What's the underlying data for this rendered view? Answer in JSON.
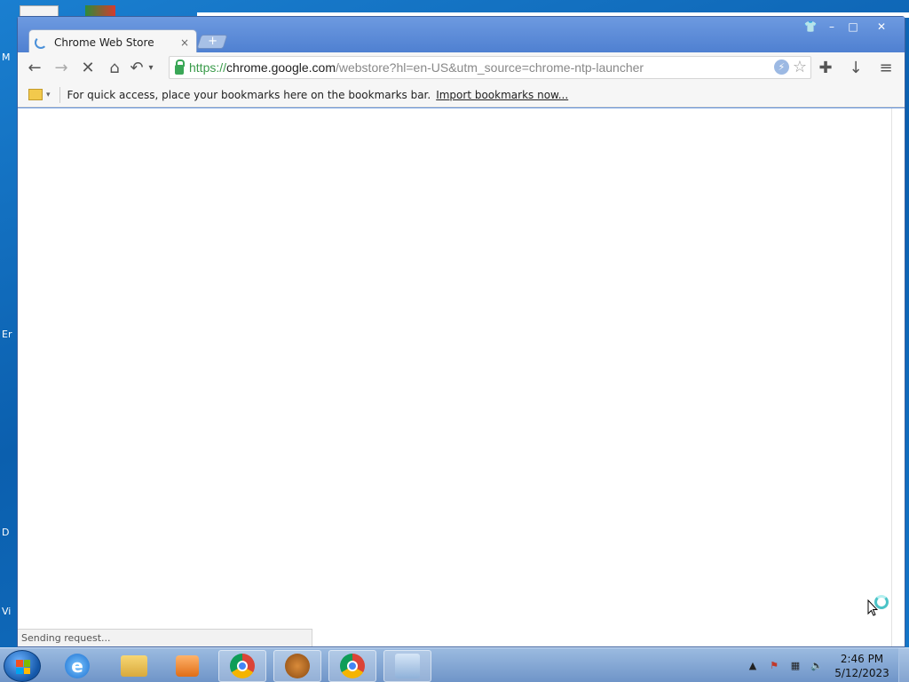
{
  "desktop": {
    "labels": [
      "M",
      "Er",
      "D",
      "Vi"
    ]
  },
  "browser": {
    "tab": {
      "title": "Chrome Web Store",
      "close_label": "×"
    },
    "new_tab_label": "+",
    "window_controls": {
      "minimize": "–",
      "maximize": "□",
      "close": "✕",
      "profile": "👕"
    },
    "toolbar": {
      "back": "←",
      "forward": "→",
      "stop": "✕",
      "home": "⌂",
      "undo": "↶",
      "undo_caret": "▾",
      "url": {
        "scheme": "https://",
        "host": "chrome.google.com",
        "rest": "/webstore?hl=en-US&utm_source=chrome-ntp-launcher"
      },
      "extensions": "✚",
      "download": "↓",
      "menu": "≡"
    },
    "bookmarks_bar": {
      "caret": "▾",
      "prompt": "For quick access, place your bookmarks here on the bookmarks bar.",
      "import_link": "Import bookmarks now..."
    },
    "status_text": "Sending request..."
  },
  "taskbar": {
    "items": [
      "internet-explorer",
      "file-explorer",
      "media-player",
      "chrome",
      "game",
      "chrome-canary",
      "control-panel"
    ],
    "tray_caret": "▲",
    "clock_time": "2:46 PM",
    "clock_date": "5/12/2023"
  },
  "colors": {
    "accent": "#5f8fd9",
    "secure_green": "#3a9b4a"
  }
}
